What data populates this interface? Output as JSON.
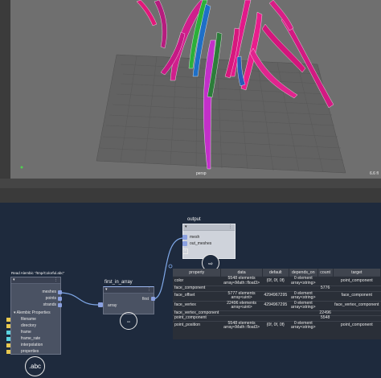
{
  "viewport": {
    "persp_label": "persp",
    "fps_label": "6.6 fl"
  },
  "read_alembic": {
    "caption": "Read Alembic \"/tmp/Colorful.abc\"",
    "outputs": [
      "meshes",
      "points",
      "strands"
    ],
    "section_label": "Alembic Properties",
    "attributes": [
      "filename",
      "directory",
      "frame",
      "frame_rate",
      "interpolation",
      "properties"
    ],
    "badge": ".abc"
  },
  "first_in_array": {
    "title": "first_in_array",
    "input": "array",
    "output": "first"
  },
  "output_node": {
    "title": "output",
    "inputs": [
      "mesh",
      "out_meshes"
    ]
  },
  "table": {
    "headers": [
      "property",
      "data",
      "default",
      "depends_on",
      "count",
      "target"
    ],
    "rows": [
      {
        "property": "color",
        "data": "5548 elements array<Math::float3>",
        "default": "{0f, 0f, 0f}",
        "depends_on": "0 element array<string>",
        "count": "",
        "target": "point_component"
      },
      {
        "property": "face_component",
        "data": "",
        "default": "",
        "depends_on": "",
        "count": "5776",
        "target": ""
      },
      {
        "property": "face_offset",
        "data": "5777 elements array<uint>",
        "default": "4294967295",
        "depends_on": "0 element array<string>",
        "count": "",
        "target": "face_component"
      },
      {
        "property": "face_vertex",
        "data": "22496 elements array<uint>",
        "default": "4294967295",
        "depends_on": "0 element array<string>",
        "count": "",
        "target": "face_vertex_component"
      },
      {
        "property": "face_vertex_component",
        "data": "",
        "default": "",
        "depends_on": "",
        "count": "22496",
        "target": ""
      },
      {
        "property": "point_component",
        "data": "",
        "default": "",
        "depends_on": "",
        "count": "5548",
        "target": ""
      },
      {
        "property": "point_position",
        "data": "5548 elements array<Math::float3>",
        "default": "{0f, 0f, 0f}",
        "depends_on": "0 element array<string>",
        "count": "",
        "target": "point_component"
      }
    ]
  },
  "colors": {
    "graph_bg": "#1e2a3d",
    "port": "#8aa0e0",
    "attr": "#e8c850",
    "wire": "#7fa8e8"
  }
}
